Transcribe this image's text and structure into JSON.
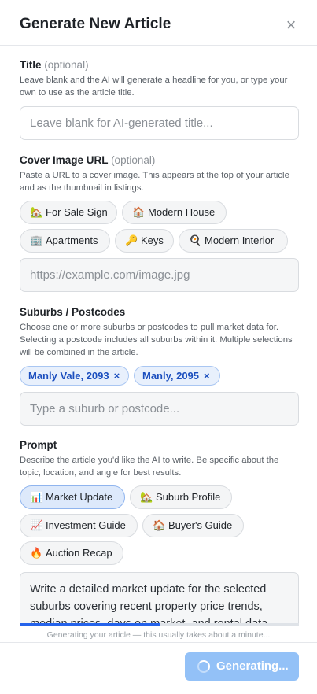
{
  "header": {
    "title": "Generate New Article",
    "close_symbol": "×"
  },
  "title_section": {
    "label": "Title",
    "optional": "(optional)",
    "help": "Leave blank and the AI will generate a headline for you, or type your own to use as the article title.",
    "placeholder": "Leave blank for AI-generated title..."
  },
  "cover_section": {
    "label": "Cover Image URL",
    "optional": "(optional)",
    "help": "Paste a URL to a cover image. This appears at the top of your article and as the thumbnail in listings.",
    "chips": [
      {
        "emoji": "🏡",
        "label": "For Sale Sign"
      },
      {
        "emoji": "🏠",
        "label": "Modern House"
      },
      {
        "emoji": "🏢",
        "label": "Apartments"
      },
      {
        "emoji": "🔑",
        "label": "Keys"
      },
      {
        "emoji": "🍳",
        "label": "Modern Interior"
      }
    ],
    "placeholder": "https://example.com/image.jpg"
  },
  "suburbs_section": {
    "label": "Suburbs / Postcodes",
    "help": "Choose one or more suburbs or postcodes to pull market data for. Selecting a postcode includes all suburbs within it. Multiple selections will be combined in the article.",
    "tags": [
      {
        "label": "Manly Vale, 2093",
        "remove": "×"
      },
      {
        "label": "Manly, 2095",
        "remove": "×"
      }
    ],
    "placeholder": "Type a suburb or postcode..."
  },
  "prompt_section": {
    "label": "Prompt",
    "help": "Describe the article you'd like the AI to write. Be specific about the topic, location, and angle for best results.",
    "chips": [
      {
        "emoji": "📊",
        "label": "Market Update",
        "active": true
      },
      {
        "emoji": "🏡",
        "label": "Suburb Profile",
        "active": false
      },
      {
        "emoji": "📈",
        "label": "Investment Guide",
        "active": false
      },
      {
        "emoji": "🏠",
        "label": "Buyer's Guide",
        "active": false
      },
      {
        "emoji": "🔥",
        "label": "Auction Recap",
        "active": false
      }
    ],
    "text": "Write a detailed market update for the selected suburbs covering recent property price trends, median prices, days on market, and rental data"
  },
  "progress": {
    "fraction": 0.5,
    "status": "Generating your article — this usually takes about a minute..."
  },
  "footer": {
    "button_label": "Generating..."
  },
  "colors": {
    "accent": "#2563eb",
    "button_disabled": "#93c1f7",
    "tag_text": "#1c4fbf"
  }
}
